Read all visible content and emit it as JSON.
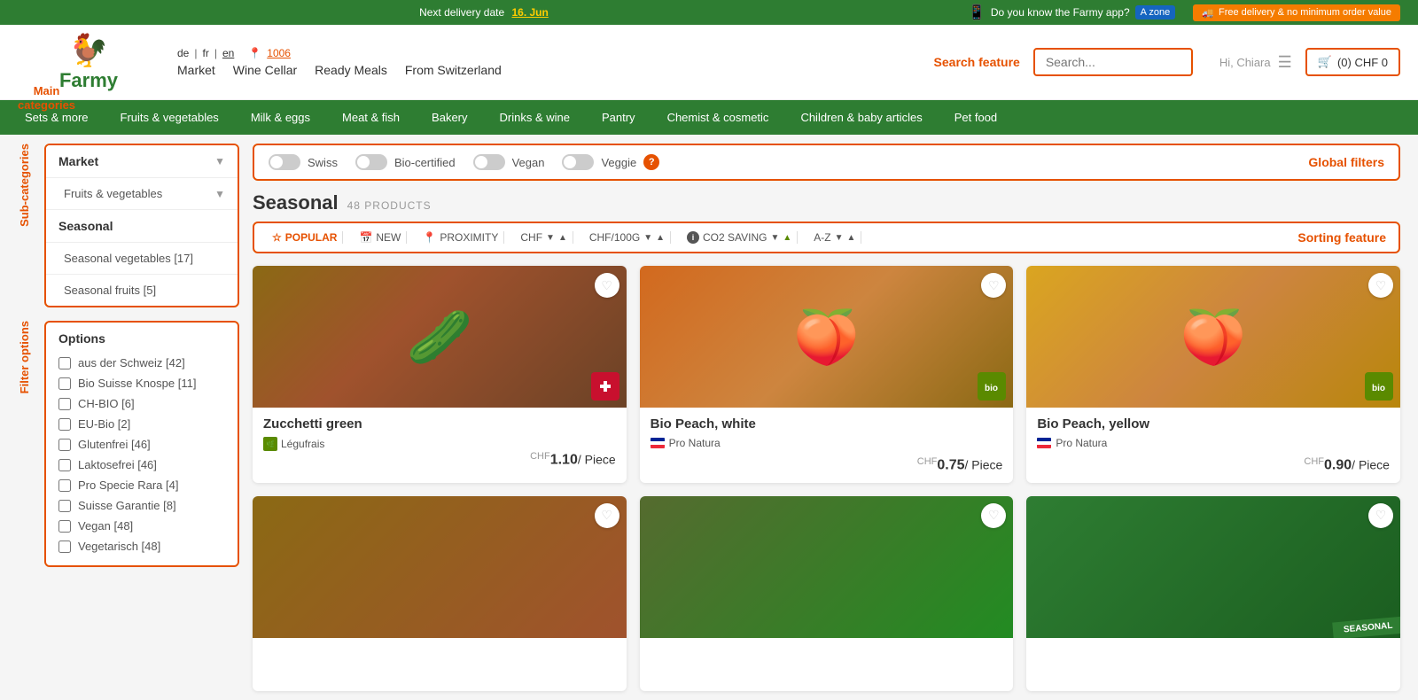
{
  "topBanner": {
    "deliveryText": "Next delivery date",
    "deliveryDate": "16. Jun",
    "appPromo": "Do you know the Farmy app?",
    "zone": "A zone",
    "freeDelivery": "Free delivery & no minimum order value"
  },
  "header": {
    "logo": "Farmy",
    "mainCategoriesLabel": "Main categories",
    "langDe": "de",
    "langFr": "fr",
    "langEn": "en",
    "locationId": "1006",
    "navLinks": [
      "Market",
      "Wine Cellar",
      "Ready Meals",
      "From Switzerland"
    ],
    "searchFeatureLabel": "Search feature",
    "searchPlaceholder": "Search...",
    "searchDash": "Search -",
    "cartLabel": "(0) CHF 0",
    "userGreeting": "Hi, Chiara"
  },
  "greenNav": {
    "items": [
      "Sets & more",
      "Fruits & vegetables",
      "Milk & eggs",
      "Meat & fish",
      "Bakery",
      "Drinks & wine",
      "Pantry",
      "Chemist & cosmetic",
      "Children & baby articles",
      "Pet food"
    ]
  },
  "sidebar": {
    "categoriesLabel": "Sub-categories",
    "filtersLabel": "Filter options",
    "categories": [
      {
        "label": "Market",
        "level": "header",
        "hasArrow": true
      },
      {
        "label": "Fruits & vegetables",
        "level": "sub-header",
        "hasArrow": true
      },
      {
        "label": "Seasonal",
        "level": "active",
        "hasArrow": false
      },
      {
        "label": "Seasonal vegetables [17]",
        "level": "deep-sub",
        "hasArrow": false
      },
      {
        "label": "Seasonal fruits [5]",
        "level": "deep-sub",
        "hasArrow": false
      }
    ],
    "optionsTitle": "Options",
    "options": [
      "aus der Schweiz [42]",
      "Bio Suisse Knospe [11]",
      "CH-BIO [6]",
      "EU-Bio [2]",
      "Glutenfrei [46]",
      "Laktosefrei [46]",
      "Pro Specie Rara [4]",
      "Suisse Garantie [8]",
      "Vegan [48]",
      "Vegetarisch [48]"
    ]
  },
  "globalFilters": {
    "label": "Global filters",
    "filters": [
      "Swiss",
      "Bio-certified",
      "Vegan",
      "Veggie"
    ]
  },
  "seasonal": {
    "title": "Seasonal",
    "productsCount": "48 PRODUCTS",
    "sortingLabel": "Sorting feature",
    "sortItems": [
      {
        "label": "POPULAR",
        "icon": "star",
        "active": true
      },
      {
        "label": "NEW",
        "icon": "calendar"
      },
      {
        "label": "PROXIMITY",
        "icon": "pin"
      },
      {
        "label": "CHF",
        "hasArrows": true
      },
      {
        "label": "CHF/100G",
        "hasArrows": true
      },
      {
        "label": "CO2 SAVING",
        "icon": "info",
        "hasArrows": true
      },
      {
        "label": "A-Z",
        "hasArrows": true
      }
    ]
  },
  "products": [
    {
      "name": "Zucchetti green",
      "provider": "Légufrais",
      "providerType": "box",
      "price": "1.10",
      "unit": "Piece",
      "cert": "swiss",
      "imageType": "zucchini",
      "emoji": "🥒"
    },
    {
      "name": "Bio Peach, white",
      "provider": "Pro Natura",
      "providerType": "flag",
      "price": "0.75",
      "unit": "Piece",
      "cert": "bio",
      "imageType": "peach-white",
      "emoji": "🍑"
    },
    {
      "name": "Bio Peach, yellow",
      "provider": "Pro Natura",
      "providerType": "flag",
      "price": "0.90",
      "unit": "Piece",
      "cert": "bio",
      "imageType": "peach-yellow",
      "emoji": "🍑"
    },
    {
      "name": "",
      "provider": "",
      "providerType": "",
      "price": "",
      "unit": "",
      "cert": "",
      "imageType": "bottom1",
      "emoji": "",
      "isSeasonal": false
    },
    {
      "name": "",
      "provider": "",
      "providerType": "",
      "price": "",
      "unit": "",
      "cert": "",
      "imageType": "bottom2",
      "emoji": ""
    },
    {
      "name": "",
      "provider": "",
      "providerType": "",
      "price": "",
      "unit": "",
      "cert": "",
      "imageType": "bottom3",
      "emoji": "",
      "isSeasonal": true,
      "seasonalLabel": "SEASONAL"
    }
  ]
}
